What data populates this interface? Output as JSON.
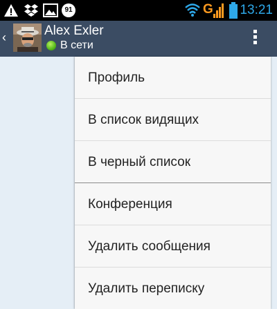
{
  "status_bar": {
    "notification_count": "91",
    "network_type": "G",
    "time": "13:21",
    "icons": [
      "warning-icon",
      "dropbox-icon",
      "image-icon",
      "notification-count-badge",
      "wifi-icon",
      "signal-icon",
      "battery-icon"
    ]
  },
  "header": {
    "back_icon": "chevron-left-icon",
    "contact_name": "Alex Exler",
    "presence": "В сети",
    "presence_color": "#55b81a",
    "overflow_icon": "overflow-menu-icon",
    "background_color": "#3b4c63"
  },
  "menu": {
    "items": [
      {
        "label": "Профиль"
      },
      {
        "label": "В список видящих"
      },
      {
        "label": "В черный список"
      },
      {
        "label": "Конференция"
      },
      {
        "label": "Удалить сообщения"
      },
      {
        "label": "Удалить переписку"
      }
    ]
  }
}
